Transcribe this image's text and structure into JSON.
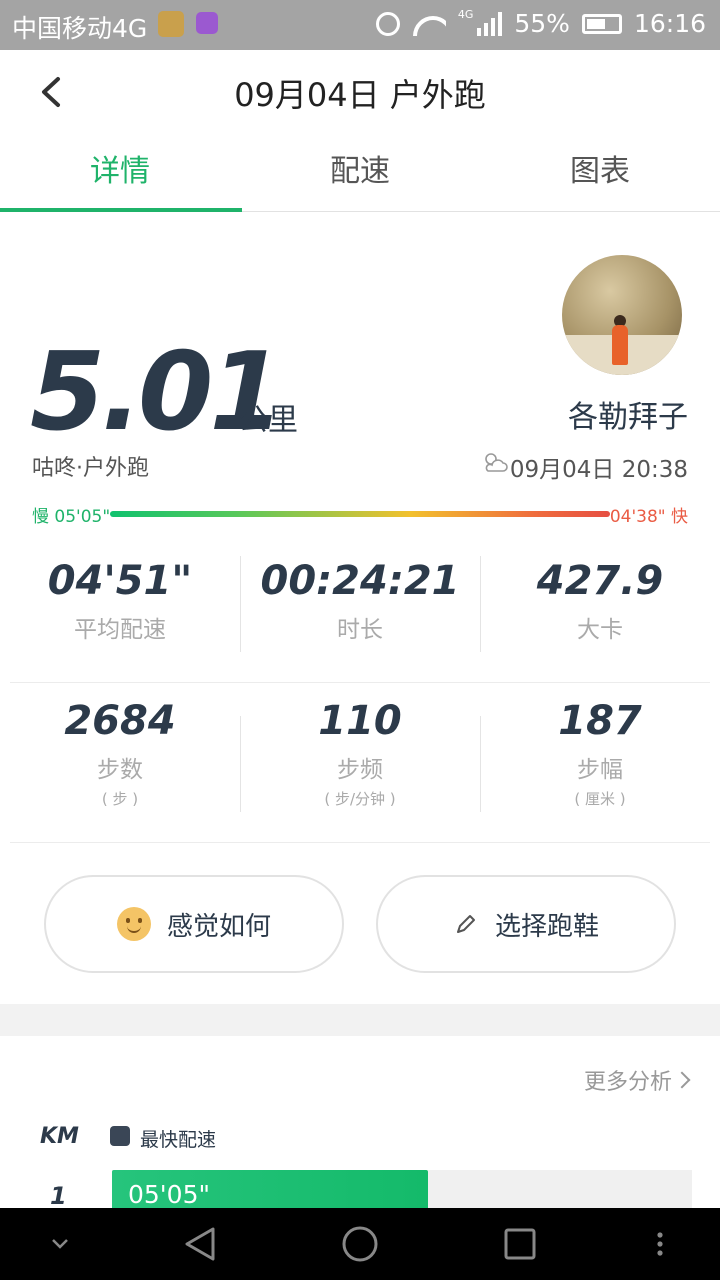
{
  "status_bar": {
    "carrier": "中国移动4G",
    "network": "4G",
    "battery": "55%",
    "time": "16:16"
  },
  "header": {
    "title": "09月04日 户外跑"
  },
  "tabs": [
    {
      "label": "详情",
      "active": true
    },
    {
      "label": "配速",
      "active": false
    },
    {
      "label": "图表",
      "active": false
    }
  ],
  "summary": {
    "distance": "5.01",
    "distance_unit": "公里",
    "run_type": "咕咚·户外跑",
    "username": "各勒拜子",
    "datetime": "09月04日 20:38",
    "weather_icon": "partly-cloudy-night-icon"
  },
  "pace_range": {
    "slow_label": "慢 05'05\"",
    "fast_label": "04'38\" 快"
  },
  "stats_row1": [
    {
      "value": "04'51\"",
      "label": "平均配速"
    },
    {
      "value": "00:24:21",
      "label": "时长"
    },
    {
      "value": "427.9",
      "label": "大卡"
    }
  ],
  "stats_row2": [
    {
      "value": "2684",
      "label": "步数",
      "unit": "( 步 )"
    },
    {
      "value": "110",
      "label": "步频",
      "unit": "( 步/分钟 )"
    },
    {
      "value": "187",
      "label": "步幅",
      "unit": "( 厘米 )"
    }
  ],
  "actions": {
    "feel_label": "感觉如何",
    "shoes_label": "选择跑鞋"
  },
  "analysis": {
    "more_label": "更多分析",
    "km_header": "KM",
    "legend_label": "最快配速",
    "splits": [
      {
        "km": "1",
        "pace": "05'05\"",
        "fraction": 0.545
      }
    ]
  },
  "colors": {
    "accent": "#1fb36a",
    "fast": "#ea5c45",
    "text_dark": "#2c3a4a"
  }
}
